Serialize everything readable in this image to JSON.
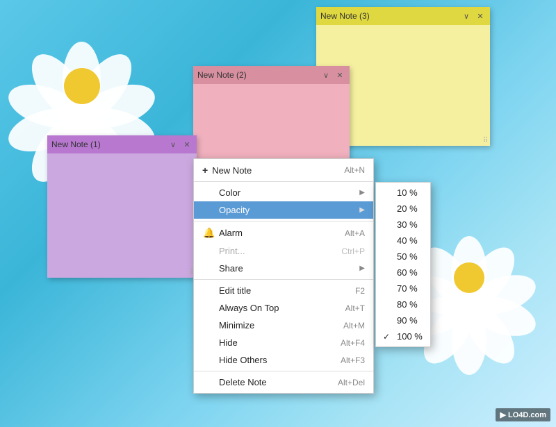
{
  "background": {
    "color_start": "#5bc8e8",
    "color_end": "#a8e4f5"
  },
  "notes": [
    {
      "id": "note-3",
      "title": "New Note (3)",
      "bg_color": "#f5f0a0",
      "title_color": "#e8e060",
      "btn_minimize": "∨",
      "btn_close": "✕"
    },
    {
      "id": "note-2",
      "title": "New Note (2)",
      "bg_color": "#f5c0c8",
      "title_color": "#e8a0aa",
      "btn_minimize": "∨",
      "btn_close": "✕"
    },
    {
      "id": "note-1",
      "title": "New Note (1)",
      "bg_color": "#d8b8e8",
      "title_color": "#c090d8",
      "btn_minimize": "∨",
      "btn_close": "✕"
    }
  ],
  "context_menu": {
    "items": [
      {
        "id": "new-note",
        "icon": "+",
        "label": "New Note",
        "shortcut": "Alt+N",
        "type": "item"
      },
      {
        "id": "separator-1",
        "type": "separator"
      },
      {
        "id": "color",
        "label": "Color",
        "shortcut": "",
        "has_arrow": true,
        "type": "item"
      },
      {
        "id": "opacity",
        "label": "Opacity",
        "shortcut": "",
        "has_arrow": true,
        "type": "item",
        "highlighted": true
      },
      {
        "id": "separator-2",
        "type": "separator"
      },
      {
        "id": "alarm",
        "icon": "🔔",
        "label": "Alarm",
        "shortcut": "Alt+A",
        "type": "item"
      },
      {
        "id": "print",
        "label": "Print...",
        "shortcut": "Ctrl+P",
        "type": "item",
        "disabled": true
      },
      {
        "id": "share",
        "label": "Share",
        "shortcut": "",
        "has_arrow": true,
        "type": "item"
      },
      {
        "id": "separator-3",
        "type": "separator"
      },
      {
        "id": "edit-title",
        "label": "Edit title",
        "shortcut": "F2",
        "type": "item"
      },
      {
        "id": "always-on-top",
        "label": "Always On Top",
        "shortcut": "Alt+T",
        "type": "item"
      },
      {
        "id": "minimize",
        "label": "Minimize",
        "shortcut": "Alt+M",
        "type": "item"
      },
      {
        "id": "hide",
        "label": "Hide",
        "shortcut": "Alt+F4",
        "type": "item"
      },
      {
        "id": "hide-others",
        "label": "Hide Others",
        "shortcut": "Alt+F3",
        "type": "item"
      },
      {
        "id": "separator-4",
        "type": "separator"
      },
      {
        "id": "delete-note",
        "label": "Delete Note",
        "shortcut": "Alt+Del",
        "type": "item"
      }
    ]
  },
  "opacity_submenu": {
    "items": [
      {
        "id": "op-10",
        "label": "10 %",
        "checked": false
      },
      {
        "id": "op-20",
        "label": "20 %",
        "checked": false
      },
      {
        "id": "op-30",
        "label": "30 %",
        "checked": false
      },
      {
        "id": "op-40",
        "label": "40 %",
        "checked": false
      },
      {
        "id": "op-50",
        "label": "50 %",
        "checked": false
      },
      {
        "id": "op-60",
        "label": "60 %",
        "checked": false
      },
      {
        "id": "op-70",
        "label": "70 %",
        "checked": false
      },
      {
        "id": "op-80",
        "label": "80 %",
        "checked": false
      },
      {
        "id": "op-90",
        "label": "90 %",
        "checked": false
      },
      {
        "id": "op-100",
        "label": "100 %",
        "checked": true
      }
    ]
  },
  "watermark": {
    "text": "▶ LO4D.com"
  }
}
